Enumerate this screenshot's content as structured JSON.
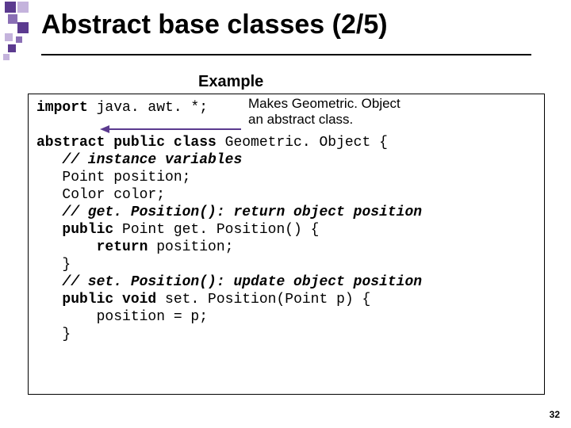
{
  "title": "Abstract base classes (2/5)",
  "example_label": "Example",
  "callout": {
    "line1": "Makes Geometric. Object",
    "line2": "an abstract class."
  },
  "code": {
    "l1a": "import",
    "l1b": " java. awt. *;",
    "l2a": "abstract public class",
    "l2b": " Geometric. Object {",
    "l3": "   // instance variables",
    "l4": "   Point position;",
    "l5": "   Color color;",
    "l6": "",
    "l7": "   // get. Position(): return object position",
    "l8a": "   public",
    "l8b": " Point get. Position() {",
    "l9a": "       return",
    "l9b": " position;",
    "l10": "   }",
    "l11": "   // set. Position(): update object position",
    "l12a": "   public void",
    "l12b": " set. Position(Point p) {",
    "l13": "       position = p;",
    "l14": "   }"
  },
  "page_number": "32",
  "colors": {
    "purple": "#5b3a8f",
    "mid": "#8a6fb5",
    "light": "#c4b3dc"
  }
}
